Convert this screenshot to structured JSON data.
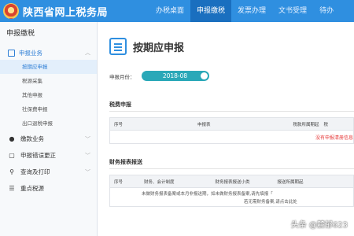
{
  "header": {
    "site_title": "陕西省网上税务局",
    "nav": [
      "办税桌面",
      "申报缴税",
      "发票办理",
      "文书受理",
      "待办"
    ]
  },
  "sidebar": {
    "title": "申报缴税",
    "group_label": "申报业务",
    "sub_items": [
      "按期应申报",
      "税源采集",
      "其他申报",
      "社保费申报",
      "出口退税申报"
    ],
    "rows": [
      "缴款业务",
      "申报错误更正",
      "查询及打印",
      "重点税源"
    ]
  },
  "main": {
    "title": "按期应申报",
    "period_label": "申报月份：",
    "period_value": "2018-08",
    "tax_section": "税费申报",
    "tax_headers": [
      "序号",
      "申报表",
      "税款所属期起",
      "税"
    ],
    "tax_empty": "没有申报清册信息",
    "fin_section": "财务报表报送",
    "fin_headers": [
      "序号",
      "财务、会计制度",
      "财务报表报送小类",
      "报送所属期起"
    ],
    "fin_notice_1": "未做财务报表备案或本月非报送期，如未做财务报表备案,请先填报「",
    "fin_notice_2": "若无需财务备案,请点击此处"
  },
  "watermark": "头条 @麓郁623"
}
